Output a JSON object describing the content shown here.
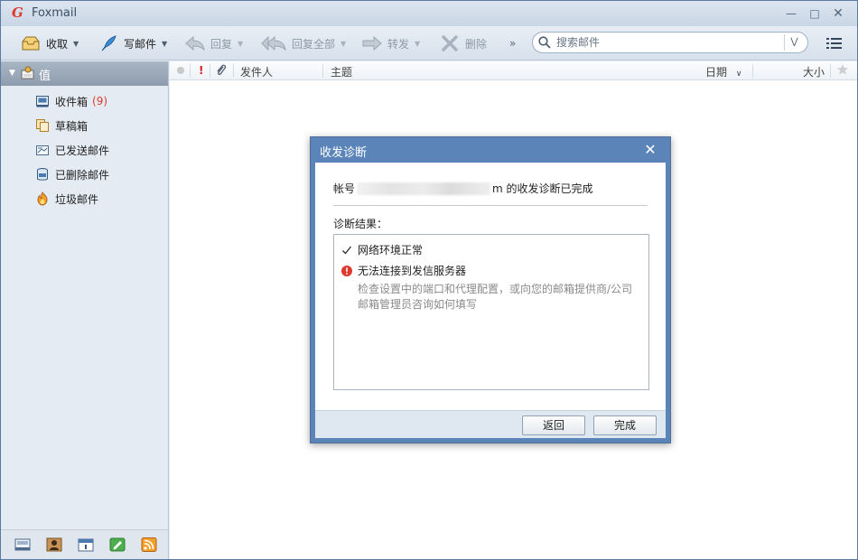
{
  "app": {
    "title": "Foxmail"
  },
  "toolbar": {
    "receive_label": "收取",
    "compose_label": "写邮件",
    "reply_label": "回复",
    "reply_all_label": "回复全部",
    "forward_label": "转发",
    "delete_label": "删除",
    "more_label": "»"
  },
  "search": {
    "placeholder": "搜索邮件"
  },
  "sidebar": {
    "account_name": "值",
    "folders": [
      {
        "label": "收件箱",
        "count": "(9)"
      },
      {
        "label": "草稿箱"
      },
      {
        "label": "已发送邮件"
      },
      {
        "label": "已删除邮件"
      },
      {
        "label": "垃圾邮件"
      }
    ]
  },
  "list_header": {
    "sender": "发件人",
    "subject": "主题",
    "date": "日期",
    "size": "大小"
  },
  "dialog": {
    "title": "收发诊断",
    "account_prefix": "帐号",
    "account_suffix": "m 的收发诊断已完成",
    "result_label": "诊断结果：",
    "results": [
      {
        "status": "ok",
        "text": "网络环境正常"
      },
      {
        "status": "error",
        "text": "无法连接到发信服务器"
      }
    ],
    "hint": "检查设置中的端口和代理配置，或向您的邮箱提供商/公司邮箱管理员咨询如何填写",
    "back_label": "返回",
    "done_label": "完成"
  },
  "colors": {
    "accent": "#5b85b8",
    "error": "#e0382c",
    "count": "#e0382c"
  }
}
